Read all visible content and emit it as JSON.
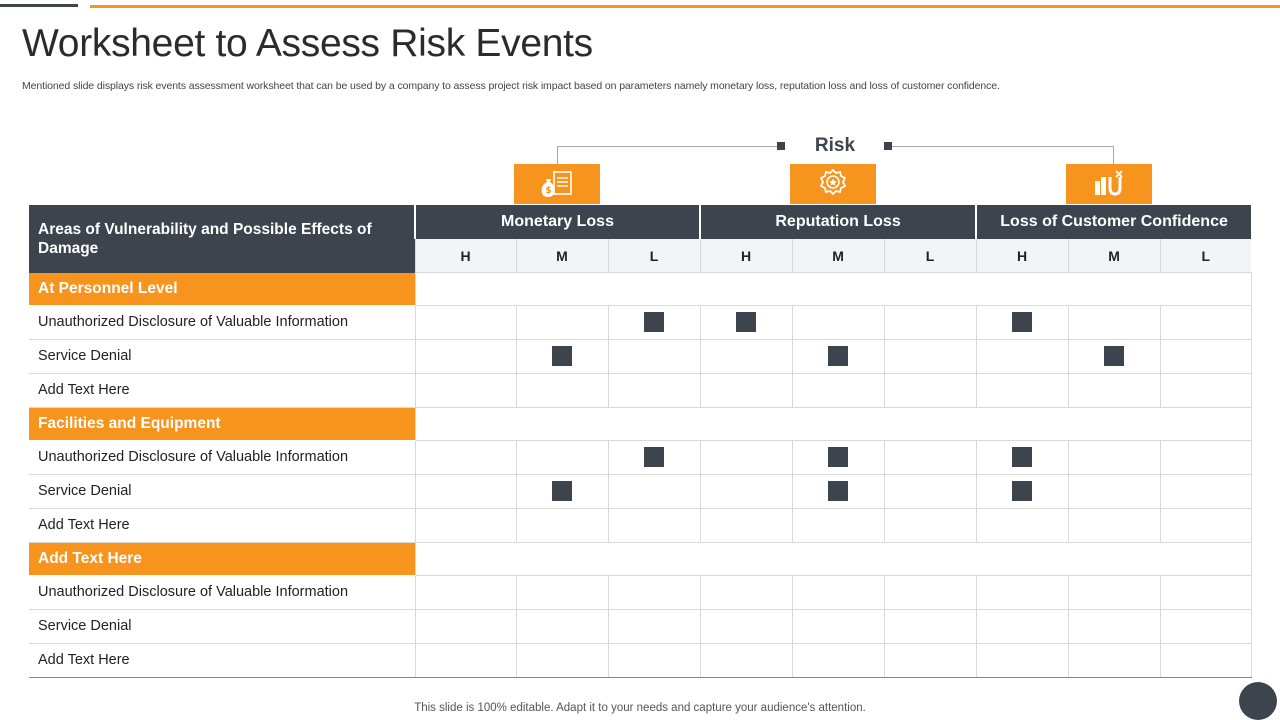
{
  "slide": {
    "title": "Worksheet to Assess Risk Events",
    "subtitle": "Mentioned slide displays risk events assessment worksheet that can be used by a company to assess project risk impact based on parameters namely monetary loss, reputation loss and loss of customer confidence.",
    "footer": "This slide is 100% editable. Adapt it to your needs and capture your audience's attention."
  },
  "risk": {
    "label": "Risk",
    "icons": [
      "money-bag-icon",
      "award-badge-icon",
      "magnet-icon"
    ]
  },
  "table": {
    "area_header": "Areas of Vulnerability and Possible Effects of Damage",
    "groups": [
      "Monetary Loss",
      "Reputation Loss",
      "Loss of Customer Confidence"
    ],
    "levels": [
      "H",
      "M",
      "L"
    ],
    "sections": [
      {
        "name": "At Personnel Level",
        "rows": [
          {
            "label": "Unauthorized Disclosure of Valuable Information",
            "marks": [
              0,
              0,
              1,
              1,
              0,
              0,
              1,
              0,
              0
            ]
          },
          {
            "label": "Service Denial",
            "marks": [
              0,
              1,
              0,
              0,
              1,
              0,
              0,
              1,
              0
            ]
          },
          {
            "label": "Add Text Here",
            "marks": [
              0,
              0,
              0,
              0,
              0,
              0,
              0,
              0,
              0
            ]
          }
        ]
      },
      {
        "name": "Facilities and Equipment",
        "rows": [
          {
            "label": "Unauthorized Disclosure of Valuable Information",
            "marks": [
              0,
              0,
              1,
              0,
              1,
              0,
              1,
              0,
              0
            ]
          },
          {
            "label": "Service Denial",
            "marks": [
              0,
              1,
              0,
              0,
              1,
              0,
              1,
              0,
              0
            ]
          },
          {
            "label": "Add Text Here",
            "marks": [
              0,
              0,
              0,
              0,
              0,
              0,
              0,
              0,
              0
            ]
          }
        ]
      },
      {
        "name": "Add Text Here",
        "rows": [
          {
            "label": "Unauthorized Disclosure of Valuable Information",
            "marks": [
              0,
              0,
              0,
              0,
              0,
              0,
              0,
              0,
              0
            ]
          },
          {
            "label": "Service Denial",
            "marks": [
              0,
              0,
              0,
              0,
              0,
              0,
              0,
              0,
              0
            ]
          },
          {
            "label": "Add Text Here",
            "marks": [
              0,
              0,
              0,
              0,
              0,
              0,
              0,
              0,
              0
            ]
          }
        ]
      }
    ]
  },
  "colors": {
    "accent": "#f7941d",
    "dark": "#3d444e"
  }
}
